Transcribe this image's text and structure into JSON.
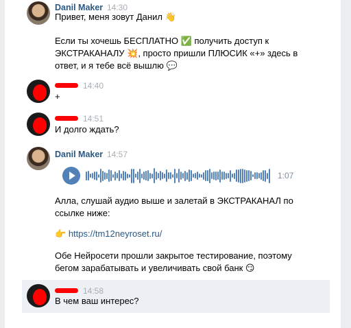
{
  "messages": {
    "m1": {
      "author": "Danil Maker",
      "time": "14:30",
      "line1": "Привет, меня зовут Данил 👋",
      "line2": "Если ты хочешь БЕСПЛАТНО ✅ получить доступ к",
      "line3": "ЭКСТРАКАНАЛУ 💥, просто пришли ПЛЮСИК «+» здесь в",
      "line4": "ответ, и я тебе всё вышлю 💬"
    },
    "m2": {
      "time": "14:40",
      "text": "+"
    },
    "m3": {
      "time": "14:51",
      "text": "И долго ждать?"
    },
    "m4": {
      "author": "Danil Maker",
      "time": "14:57",
      "audio_duration": "1:07",
      "p1a": "Алла, слушай аудио выше и залетай в ЭКСТРАКАНАЛ по",
      "p1b": "ссылке ниже:",
      "link_prefix": "👉",
      "link": "https://tm12neyroset.ru/",
      "p3a": "Обе Нейросети прошли закрытое тестирование, поэтому",
      "p3b": "бегом зарабатывать и увеличивать свой банк 😏"
    },
    "m5": {
      "time": "14:58",
      "text": "В чем ваш интерес?"
    }
  },
  "colors": {
    "accent": "#2a5885",
    "redaction": "#ff0000",
    "play": "#5181b8"
  }
}
